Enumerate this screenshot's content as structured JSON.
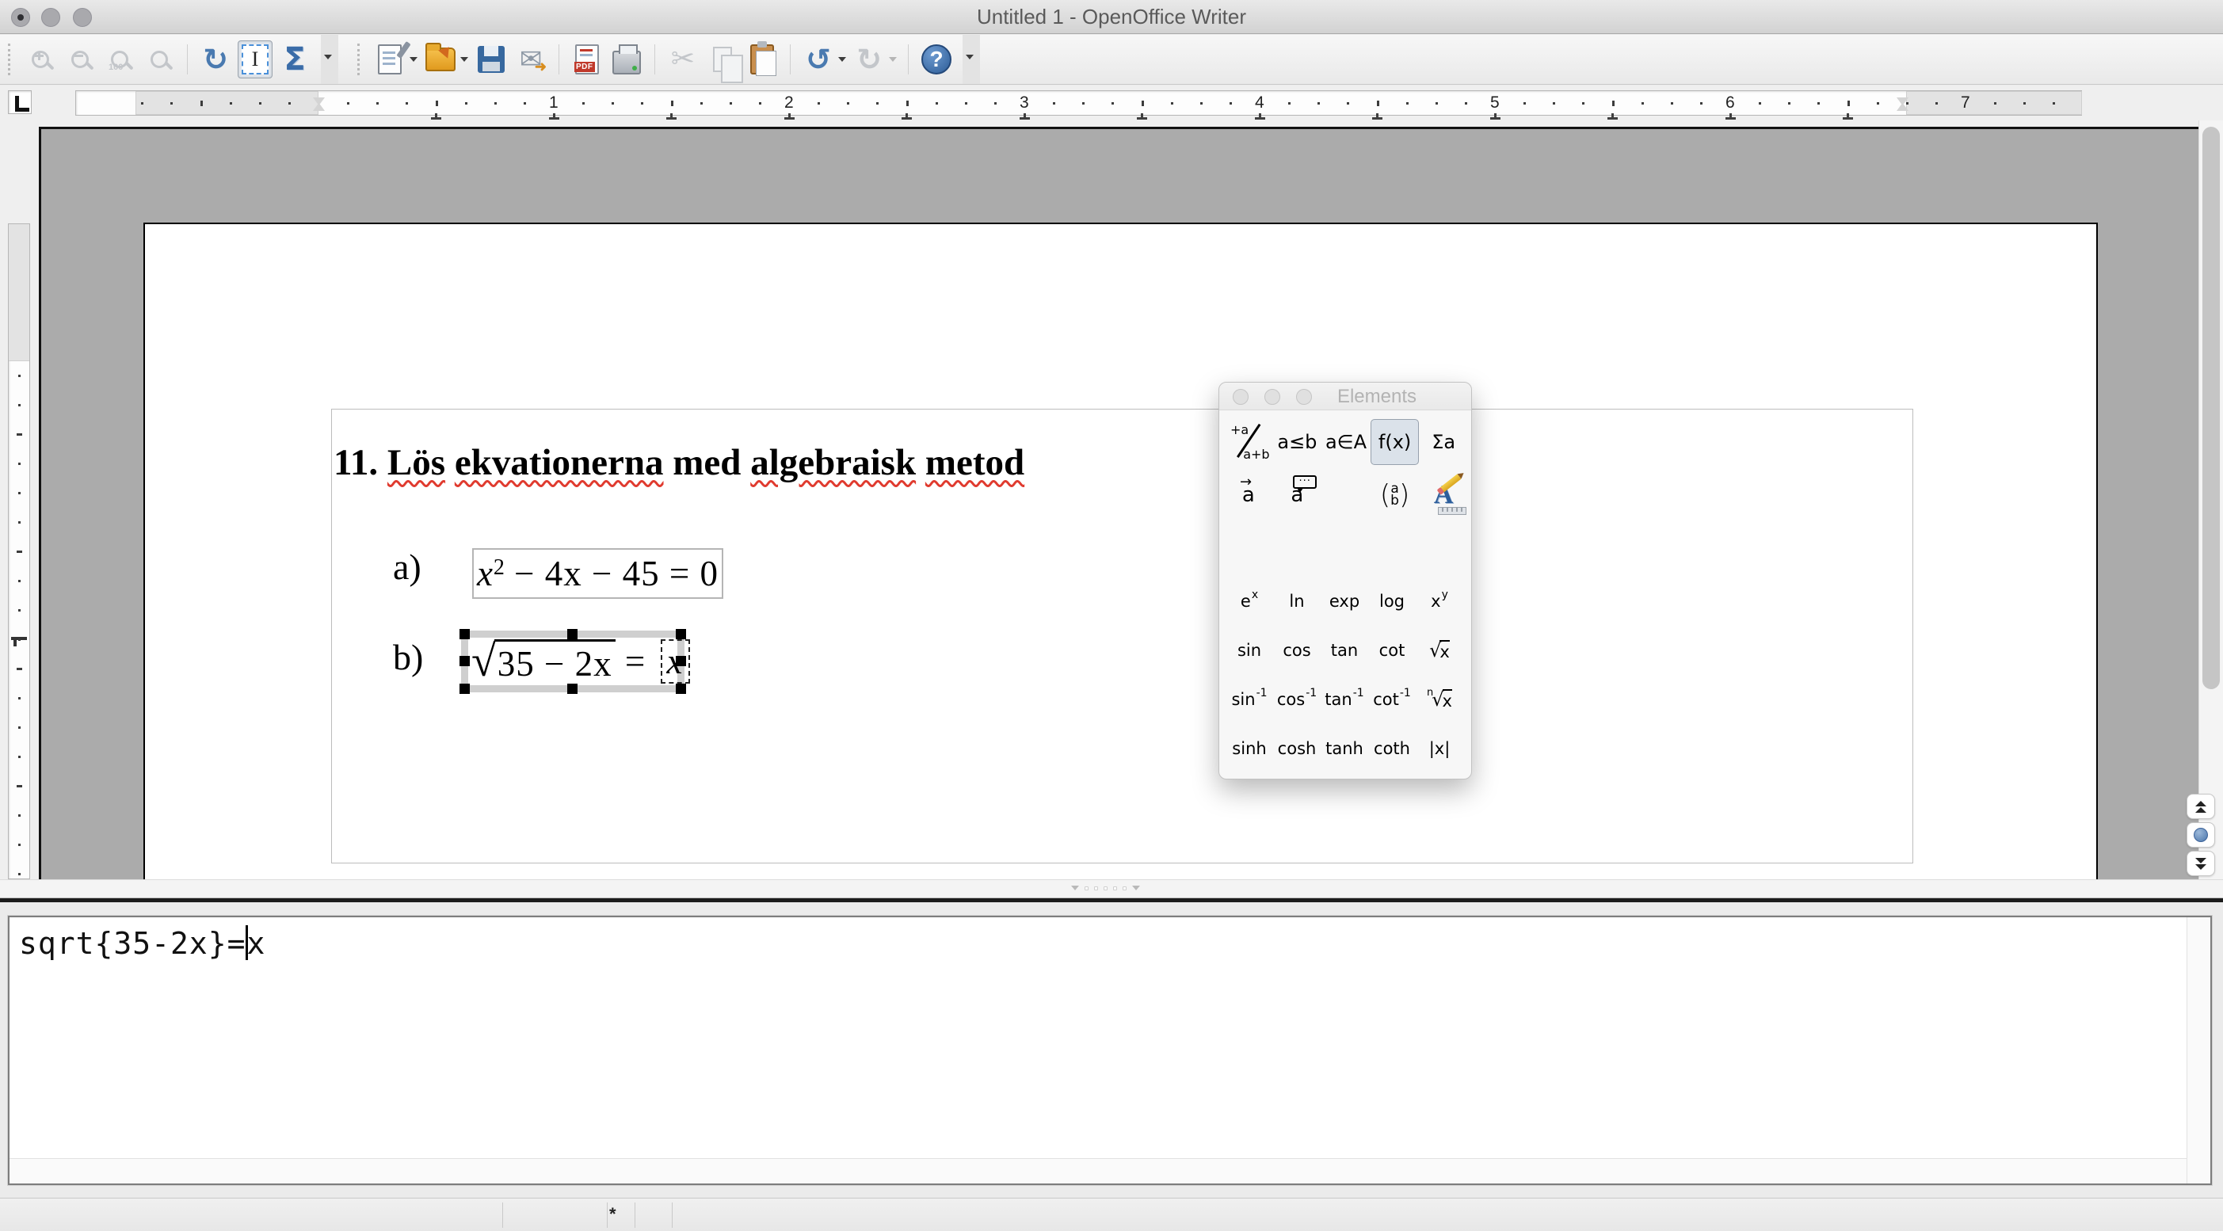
{
  "window": {
    "title": "Untitled 1 - OpenOffice Writer",
    "controls": [
      "close",
      "minimize",
      "zoom"
    ]
  },
  "toolbar_math": {
    "buttons": [
      "zoom-in",
      "zoom-out",
      "zoom-100",
      "zoom-fit",
      "refresh",
      "formula-cursor",
      "elements"
    ],
    "disabled": [
      "zoom-in",
      "zoom-out",
      "zoom-100",
      "zoom-fit"
    ],
    "toggled": "formula-cursor",
    "zoom100_label": "100",
    "refresh_glyph": "↻",
    "sigma_glyph": "Σ"
  },
  "toolbar_standard": {
    "buttons": [
      "new-document",
      "open",
      "save",
      "email-document",
      "export-pdf",
      "print",
      "cut",
      "copy",
      "paste",
      "undo",
      "redo",
      "help"
    ],
    "disabled": [
      "cut",
      "copy",
      "redo"
    ],
    "pdf_label": "PDF",
    "email_glyph": "✉",
    "email_arrow_glyph": "➜",
    "cut_glyph": "✂",
    "undo_glyph": "↺",
    "redo_glyph": "↻",
    "help_glyph": "?"
  },
  "ruler": {
    "unit": "inch",
    "numbers": [
      "1",
      "2",
      "3",
      "4",
      "5",
      "6",
      "7"
    ]
  },
  "document": {
    "heading": {
      "parts": [
        {
          "text": "11. ",
          "misspelled": false
        },
        {
          "text": "Lös",
          "misspelled": true
        },
        {
          "text": " ",
          "misspelled": false
        },
        {
          "text": "ekvationerna",
          "misspelled": true
        },
        {
          "text": " med ",
          "misspelled": false
        },
        {
          "text": "algebraisk",
          "misspelled": true
        },
        {
          "text": " ",
          "misspelled": false
        },
        {
          "text": "metod",
          "misspelled": true
        }
      ]
    },
    "items": [
      {
        "label": "a)",
        "formula": {
          "variable": "x",
          "exponent": "2",
          "rest": " − 4x − 45 = 0"
        }
      },
      {
        "label": "b)",
        "selected": true,
        "formula": {
          "radical": "√",
          "radicand": "35 − 2x",
          "equals": " = ",
          "rhs": "x"
        }
      }
    ]
  },
  "elements_palette": {
    "title": "Elements",
    "categories": [
      {
        "name": "unary-binary-operators",
        "top": "+a",
        "bottom": "a+b"
      },
      {
        "name": "relations",
        "glyph": "a≤b"
      },
      {
        "name": "set-operations",
        "glyph": "a∈A"
      },
      {
        "name": "functions",
        "glyph": "f(x)",
        "selected": true
      },
      {
        "name": "operators",
        "glyph": "Σa"
      },
      {
        "name": "attributes",
        "glyph": "a",
        "arrow": "→"
      },
      {
        "name": "others",
        "glyph": "a",
        "balloon": "···"
      },
      {
        "name": "brackets",
        "open": "(",
        "top": "a",
        "bottom": "b",
        "close": ")"
      },
      {
        "name": "formats",
        "glyph": "A"
      }
    ],
    "functions": [
      {
        "name": "e^x",
        "base": "e",
        "sup": "x"
      },
      {
        "name": "ln",
        "base": "ln"
      },
      {
        "name": "exp",
        "base": "exp"
      },
      {
        "name": "log",
        "base": "log"
      },
      {
        "name": "x^y",
        "base": "x",
        "sup": "y"
      },
      {
        "name": "sin",
        "base": "sin"
      },
      {
        "name": "cos",
        "base": "cos"
      },
      {
        "name": "tan",
        "base": "tan"
      },
      {
        "name": "cot",
        "base": "cot"
      },
      {
        "name": "sqrt",
        "radical": "√",
        "radicand": "x"
      },
      {
        "name": "sin-inverse",
        "base": "sin",
        "sup": "-1"
      },
      {
        "name": "cos-inverse",
        "base": "cos",
        "sup": "-1"
      },
      {
        "name": "tan-inverse",
        "base": "tan",
        "sup": "-1"
      },
      {
        "name": "cot-inverse",
        "base": "cot",
        "sup": "-1"
      },
      {
        "name": "nth-root",
        "pre": "n",
        "radical": "√",
        "radicand": "x"
      },
      {
        "name": "sinh",
        "base": "sinh"
      },
      {
        "name": "cosh",
        "base": "cosh"
      },
      {
        "name": "tanh",
        "base": "tanh"
      },
      {
        "name": "coth",
        "base": "coth"
      },
      {
        "name": "abs",
        "base": "|x|"
      }
    ]
  },
  "formula_editor": {
    "before_cursor": "sqrt{35-2x}=",
    "after_cursor": "x"
  },
  "status_bar": {
    "modified_indicator": "*"
  }
}
